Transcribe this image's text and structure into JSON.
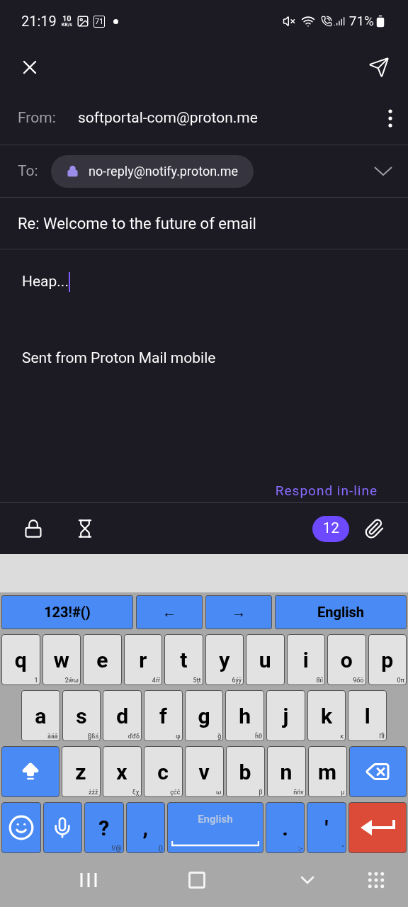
{
  "status_bar": {
    "time": "21:19",
    "speed": "10",
    "speed_unit": "KB/s",
    "badge": "71",
    "battery": "71%"
  },
  "compose": {
    "from_label": "From:",
    "from": "softportal-com@proton.me",
    "to_label": "To:",
    "recipient": "no-reply@notify.proton.me",
    "subject": "Re: Welcome to the future of email",
    "body": "Heap...",
    "signature": "Sent from Proton Mail mobile",
    "respond": "Respond in-line",
    "counter": "12"
  },
  "keyboard": {
    "top_row": [
      "123!#()",
      "←",
      "→",
      "English"
    ],
    "rows": [
      {
        "keys": [
          {
            "kind": "letter",
            "label": "q",
            "hint": "1"
          },
          {
            "kind": "letter",
            "label": "w",
            "hint": "2ŵω"
          },
          {
            "kind": "letter",
            "label": "e"
          },
          {
            "kind": "letter",
            "label": "r",
            "hint": "4ŕř"
          },
          {
            "kind": "letter",
            "label": "t",
            "hint": "5ţŧ"
          },
          {
            "kind": "letter",
            "label": "y",
            "hint": "6ýÿ"
          },
          {
            "kind": "letter",
            "label": "u"
          },
          {
            "kind": "letter",
            "label": "i",
            "hint": "8ïî"
          },
          {
            "kind": "letter",
            "label": "o",
            "hint": "9őö"
          },
          {
            "kind": "letter",
            "label": "p",
            "hint": "0π"
          }
        ]
      },
      {
        "keys": [
          {
            "kind": "letter",
            "label": "a",
            "hint": "àáâ"
          },
          {
            "kind": "letter",
            "label": "s",
            "hint": "§ßś"
          },
          {
            "kind": "letter",
            "label": "d",
            "hint": "ďđδ"
          },
          {
            "kind": "letter",
            "label": "f",
            "hint": "φ"
          },
          {
            "kind": "letter",
            "label": "g",
            "hint": "ğ"
          },
          {
            "kind": "letter",
            "label": "h",
            "hint": "ĥθ"
          },
          {
            "kind": "letter",
            "label": "j"
          },
          {
            "kind": "letter",
            "label": "k",
            "hint": "κ"
          },
          {
            "kind": "letter",
            "label": "l",
            "hint": "ľĺł"
          }
        ]
      },
      {
        "keys": [
          {
            "kind": "shift"
          },
          {
            "kind": "letter",
            "label": "z",
            "hint": "żźž"
          },
          {
            "kind": "letter",
            "label": "x",
            "hint": "ξχ"
          },
          {
            "kind": "letter",
            "label": "c",
            "hint": "çćč"
          },
          {
            "kind": "letter",
            "label": "v",
            "hint": "ω"
          },
          {
            "kind": "letter",
            "label": "b",
            "hint": "β"
          },
          {
            "kind": "letter",
            "label": "n",
            "hint": "ñńv"
          },
          {
            "kind": "letter",
            "label": "m",
            "hint": "μ"
          },
          {
            "kind": "backspace"
          }
        ]
      },
      {
        "keys": [
          {
            "kind": "emoji"
          },
          {
            "kind": "mic"
          },
          {
            "kind": "symbol",
            "label": "?",
            "hint": "!/@"
          },
          {
            "kind": "symbol",
            "label": ",",
            "hint": "()"
          },
          {
            "kind": "space",
            "label": "English"
          },
          {
            "kind": "symbol",
            "label": ".",
            "hint": ":;-"
          },
          {
            "kind": "symbol",
            "label": "'",
            "hint": "\""
          },
          {
            "kind": "enter"
          }
        ]
      }
    ]
  }
}
